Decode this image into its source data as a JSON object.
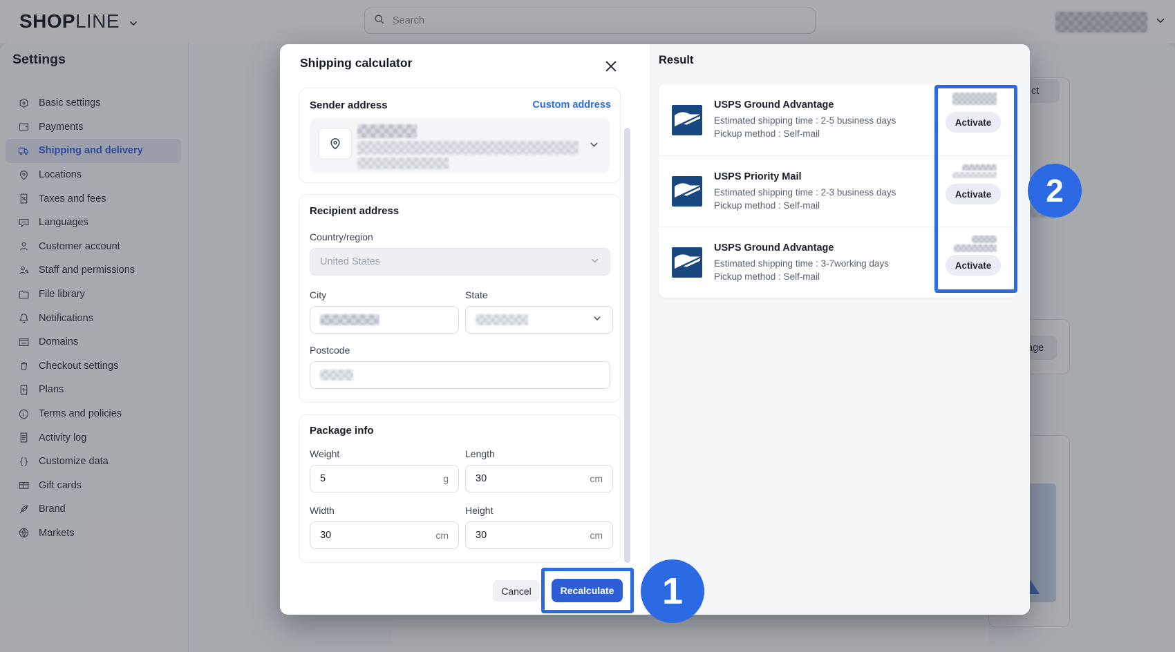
{
  "header": {
    "logo_primary": "SHOP",
    "logo_secondary": "LINE",
    "search_placeholder": "Search"
  },
  "page": {
    "title": "Settings"
  },
  "sidebar": {
    "items": [
      {
        "label": "Basic settings"
      },
      {
        "label": "Payments"
      },
      {
        "label": "Shipping and delivery",
        "active": true
      },
      {
        "label": "Locations"
      },
      {
        "label": "Taxes and fees"
      },
      {
        "label": "Languages"
      },
      {
        "label": "Customer account"
      },
      {
        "label": "Staff and permissions"
      },
      {
        "label": "File library"
      },
      {
        "label": "Notifications"
      },
      {
        "label": "Domains"
      },
      {
        "label": "Checkout settings"
      },
      {
        "label": "Plans"
      },
      {
        "label": "Terms and policies"
      },
      {
        "label": "Activity log"
      },
      {
        "label": "Customize data"
      },
      {
        "label": "Gift cards"
      },
      {
        "label": "Brand"
      },
      {
        "label": "Markets"
      }
    ]
  },
  "modal": {
    "title": "Shipping calculator",
    "sender": {
      "heading": "Sender address",
      "link": "Custom address"
    },
    "recipient": {
      "heading": "Recipient address",
      "country_label": "Country/region",
      "country_value": "United States",
      "city_label": "City",
      "state_label": "State",
      "postcode_label": "Postcode"
    },
    "package": {
      "heading": "Package info",
      "weight_label": "Weight",
      "weight_value": "5",
      "weight_unit": "g",
      "length_label": "Length",
      "length_value": "30",
      "length_unit": "cm",
      "width_label": "Width",
      "width_value": "30",
      "width_unit": "cm",
      "height_label": "Height",
      "height_value": "30",
      "height_unit": "cm"
    },
    "cancel_label": "Cancel",
    "recalculate_label": "Recalculate"
  },
  "result": {
    "heading": "Result",
    "items": [
      {
        "name": "USPS Ground Advantage",
        "eta": "Estimated shipping time : 2-5 business days",
        "pickup": "Pickup method : Self-mail",
        "action": "Activate"
      },
      {
        "name": "USPS Priority Mail",
        "eta": "Estimated shipping time : 2-3 business days",
        "pickup": "Pickup method : Self-mail",
        "action": "Activate"
      },
      {
        "name": "USPS Ground Advantage",
        "eta": "Estimated shipping time : 3-7working days",
        "pickup": "Pickup method : Self-mail",
        "action": "Activate"
      }
    ]
  },
  "background": {
    "fragment_ct": "ct",
    "fragment_age": "age"
  },
  "annotations": {
    "step1": "1",
    "step2": "2"
  },
  "colors": {
    "accent_blue": "#2b6ae3",
    "button_blue": "#2e5ed6",
    "link_blue": "#2b6cf0",
    "usps_blue": "#19477f",
    "sidebar_active": "#3a63dd"
  }
}
